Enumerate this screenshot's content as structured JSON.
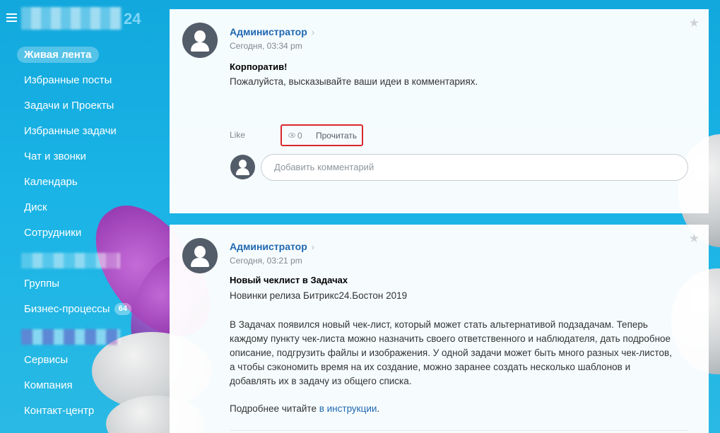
{
  "sidebar": {
    "logo_suffix": "24",
    "items": [
      {
        "label": "Живая лента",
        "active": true
      },
      {
        "label": "Избранные посты"
      },
      {
        "label": "Задачи и Проекты"
      },
      {
        "label": "Избранные задачи"
      },
      {
        "label": "Чат и звонки"
      },
      {
        "label": "Календарь"
      },
      {
        "label": "Диск"
      },
      {
        "label": "Сотрудники"
      },
      {
        "label": "Группы"
      },
      {
        "label": "Бизнес-процессы",
        "badge": "64"
      },
      {
        "label": "Сервисы"
      },
      {
        "label": "Компания"
      },
      {
        "label": "Контакт-центр"
      }
    ]
  },
  "posts": [
    {
      "author": "Администратор",
      "date": "Сегодня, 03:34 pm",
      "title": "Корпоратив!",
      "body": "Пожалуйста, высказывайте ваши идеи в комментариях.",
      "like_label": "Like",
      "views_count": "0",
      "read_label": "Прочитать",
      "comment_placeholder": "Добавить комментарий"
    },
    {
      "author": "Администратор",
      "date": "Сегодня, 03:21 pm",
      "title": "Новый чеклист в Задачах",
      "subtitle": "Новинки релиза Битрикс24.Бостон 2019",
      "para_lines": [
        "В Задачах появился новый чек-лист, который может стать альтернативой подзадачам. Теперь",
        "каждому пункту чек-листа можно назначить своего ответственного и наблюдателя, дать подробное",
        "описание, подгрузить файлы и изображения. У одной задачи может быть много разных чек-листов,",
        "а чтобы сэкономить время на их создание, можно заранее создать несколько шаблонов и",
        "добавлять их в задачу из общего списка."
      ],
      "more_prefix": "Подробнее читайте ",
      "more_link": "в инструкции",
      "more_suffix": "."
    }
  ],
  "colors": {
    "accent": "#2067b0",
    "highlight_border": "#d9282d",
    "background": "#1ab4e6"
  }
}
